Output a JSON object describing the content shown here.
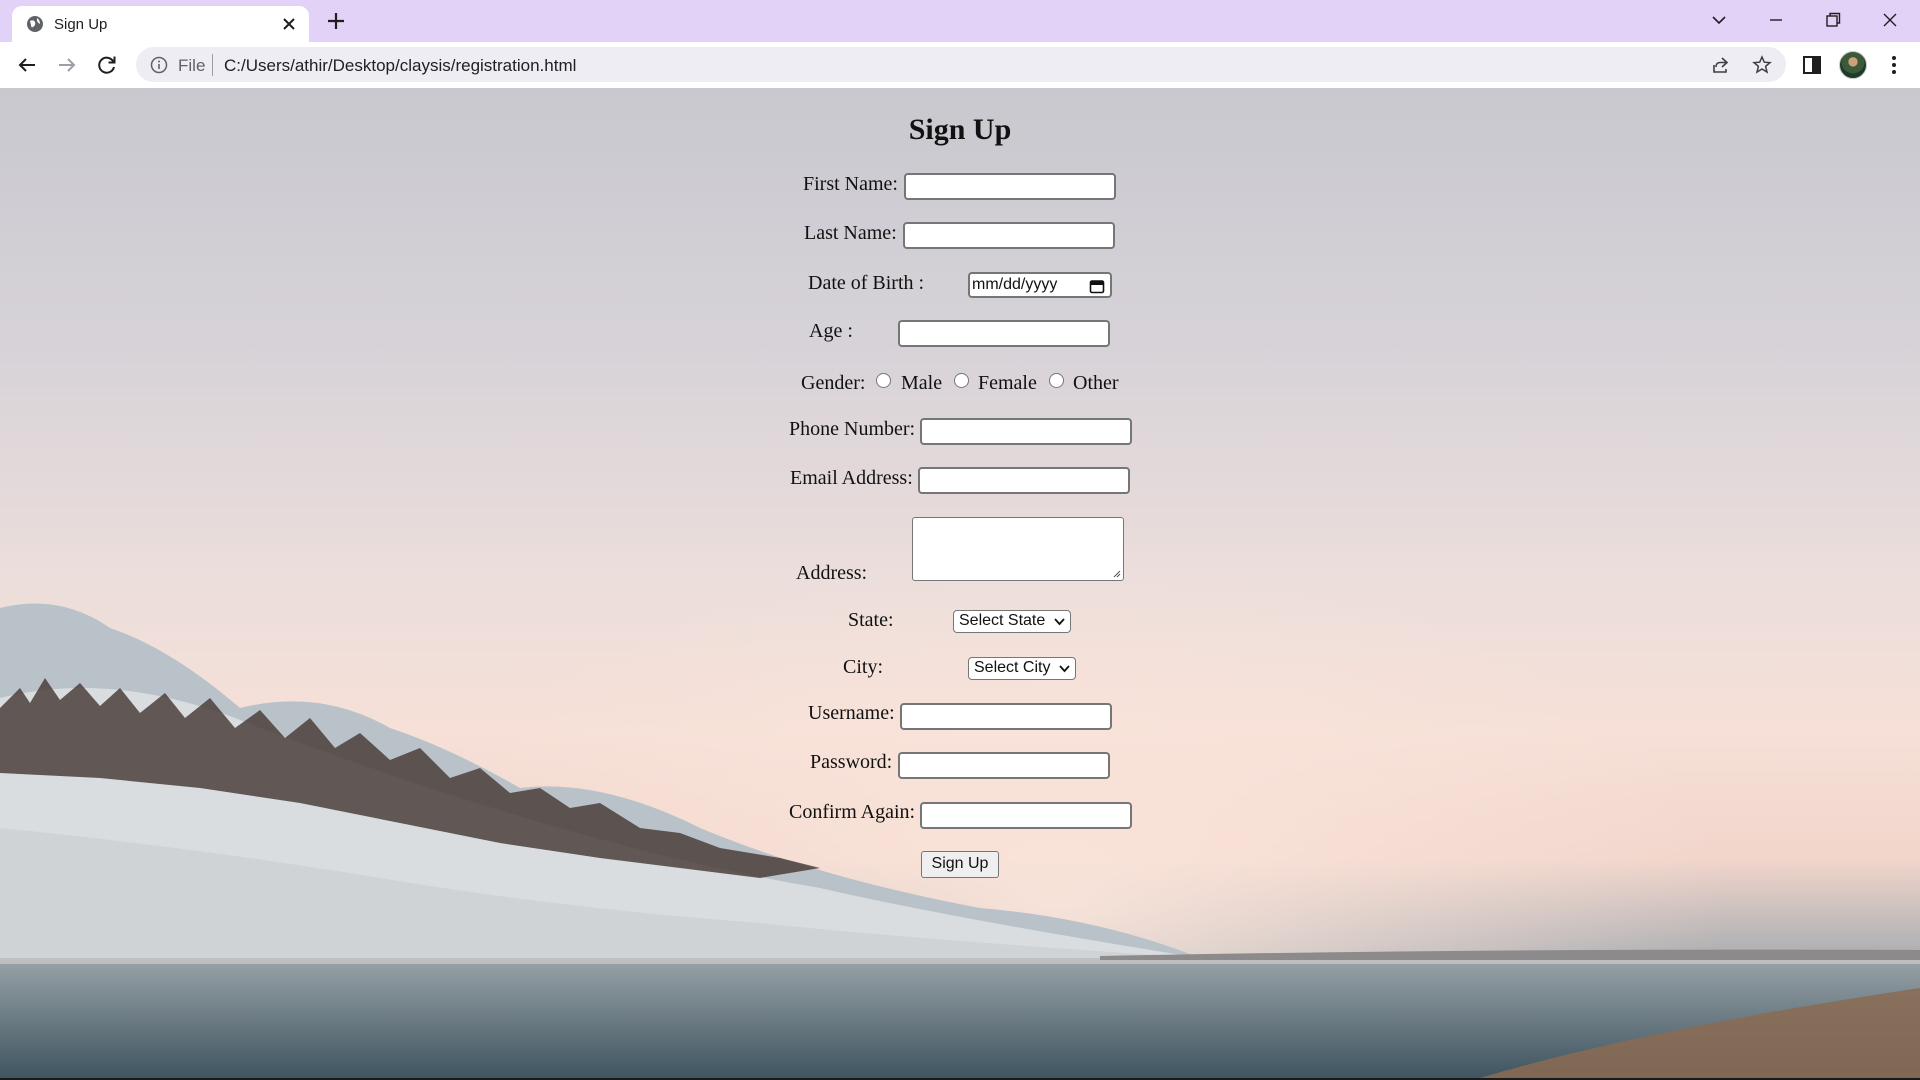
{
  "browser": {
    "tab_title": "Sign Up",
    "url_scheme": "File",
    "url": "C:/Users/athir/Desktop/claysis/registration.html"
  },
  "form": {
    "heading": "Sign Up",
    "first_name_label": "First Name:",
    "last_name_label": "Last Name:",
    "dob_label": "Date of Birth :",
    "dob_placeholder": "mm/dd/yyyy",
    "age_label": "Age :",
    "gender_label": "Gender:",
    "gender_options": [
      "Male",
      "Female",
      "Other"
    ],
    "phone_label": "Phone Number:",
    "email_label": "Email Address:",
    "address_label": "Address:",
    "state_label": "State:",
    "state_selected": "Select State",
    "city_label": "City:",
    "city_selected": "Select City",
    "username_label": "Username:",
    "password_label": "Password:",
    "confirm_label": "Confirm Again:",
    "submit_label": "Sign Up"
  }
}
